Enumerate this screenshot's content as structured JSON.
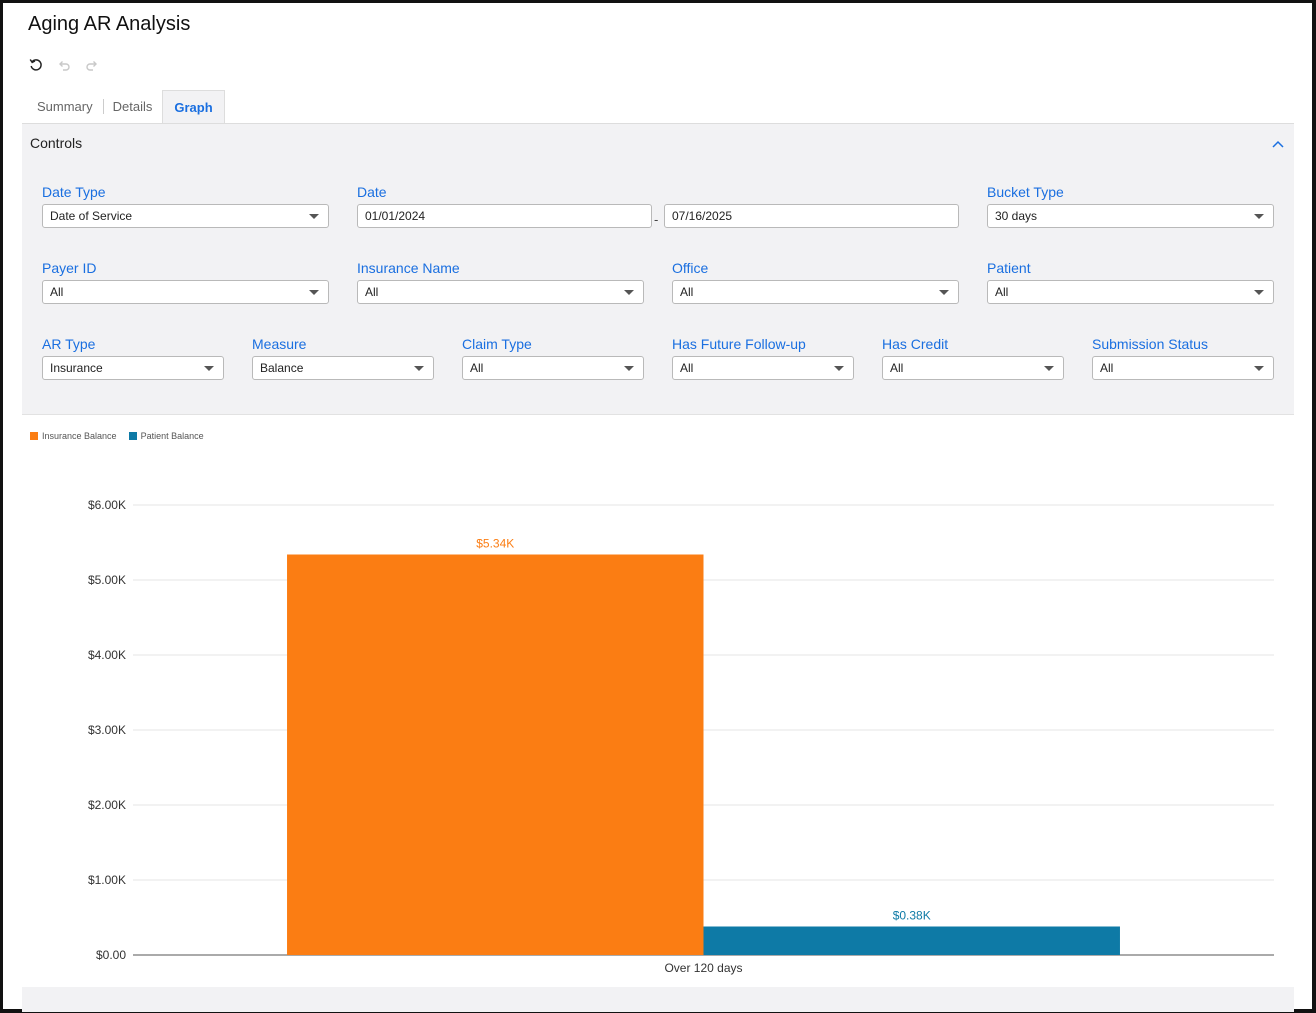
{
  "page": {
    "title": "Aging AR Analysis"
  },
  "toolbar": {
    "refresh_icon": "refresh-icon",
    "undo_icon": "undo-icon",
    "redo_icon": "redo-icon"
  },
  "tabs": [
    {
      "label": "Summary",
      "active": false
    },
    {
      "label": "Details",
      "active": false
    },
    {
      "label": "Graph",
      "active": true
    }
  ],
  "controls": {
    "header": "Controls",
    "date_type": {
      "label": "Date Type",
      "value": "Date of Service"
    },
    "date": {
      "label": "Date",
      "from": "01/01/2024",
      "separator": "-",
      "to": "07/16/2025"
    },
    "bucket_type": {
      "label": "Bucket Type",
      "value": "30 days"
    },
    "payer_id": {
      "label": "Payer ID",
      "value": "All"
    },
    "insurance_name": {
      "label": "Insurance Name",
      "value": "All"
    },
    "office": {
      "label": "Office",
      "value": "All"
    },
    "patient": {
      "label": "Patient",
      "value": "All"
    },
    "ar_type": {
      "label": "AR Type",
      "value": "Insurance"
    },
    "measure": {
      "label": "Measure",
      "value": "Balance"
    },
    "claim_type": {
      "label": "Claim Type",
      "value": "All"
    },
    "has_future_followup": {
      "label": "Has Future Follow-up",
      "value": "All"
    },
    "has_credit": {
      "label": "Has Credit",
      "value": "All"
    },
    "submission_status": {
      "label": "Submission Status",
      "value": "All"
    }
  },
  "colors": {
    "accent": "#1a6fe0",
    "insurance": "#fb7d13",
    "patient": "#0e7aa6"
  },
  "chart_data": {
    "type": "bar",
    "categories": [
      "Over 120 days"
    ],
    "series": [
      {
        "name": "Insurance Balance",
        "values": [
          5340
        ],
        "label": "$5.34K",
        "color": "#fb7d13"
      },
      {
        "name": "Patient Balance",
        "values": [
          380
        ],
        "label": "$0.38K",
        "color": "#0e7aa6"
      }
    ],
    "ylim": [
      0,
      6000
    ],
    "yticks": [
      0,
      1000,
      2000,
      3000,
      4000,
      5000,
      6000
    ],
    "ytick_labels": [
      "$0.00",
      "$1.00K",
      "$2.00K",
      "$3.00K",
      "$4.00K",
      "$5.00K",
      "$6.00K"
    ],
    "grid": true,
    "legend_position": "top-left",
    "title": "",
    "xlabel": "",
    "ylabel": ""
  }
}
